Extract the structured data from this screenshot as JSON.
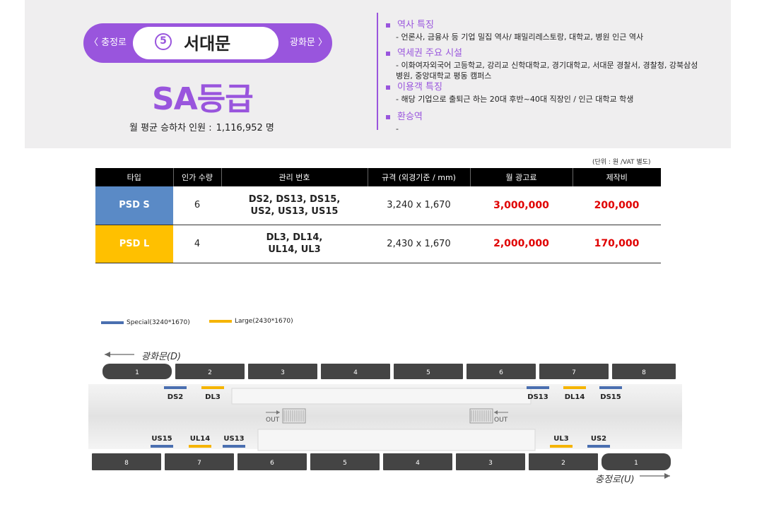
{
  "station": {
    "prev": "〈 충정로",
    "next": "광화문 〉",
    "line_number": "5",
    "name": "서대문",
    "grade": "SA등급",
    "ridership_label": "월 평균 승하차 인원 :",
    "ridership_value": "1,116,952 명",
    "accent_color": "#9955dd"
  },
  "info": [
    {
      "head": "역사 특징",
      "body": "-  언론사, 금융사 등 기업 밀집 역사/ 패밀리레스토랑, 대학교, 병원 인근 역사"
    },
    {
      "head": "역세권 주요 시설",
      "body": "-  이화여자외국어 고등학교, 강리교 신학대학교, 경기대학교, 서대문 경찰서, 경찰청, 강북삼성병원, 중앙대학교 평동 캠퍼스"
    },
    {
      "head": "이용객 특징",
      "body": "-      해당 기업으로 출퇴근 하는 20대 후반~40대 직장인 / 인근 대학교 학생"
    },
    {
      "head": "환승역",
      "body": "-"
    }
  ],
  "table": {
    "unit_note": "(단위 : 원 /VAT 별도)",
    "headers": [
      "타입",
      "인가 수량",
      "관리 번호",
      "규격 (외경기준 / mm)",
      "월 광고료",
      "제작비"
    ],
    "rows": [
      {
        "type": "PSD S",
        "qty": "6",
        "codes_1": "DS2, DS13, DS15,",
        "codes_2": "US2, US13, US15",
        "size": "3,240 x 1,670",
        "fee": "3,000,000",
        "cost": "200,000"
      },
      {
        "type": "PSD L",
        "qty": "4",
        "codes_1": "DL3, DL14,",
        "codes_2": "UL14, UL3",
        "size": "2,430 x 1,670",
        "fee": "2,000,000",
        "cost": "170,000"
      }
    ]
  },
  "legend": {
    "special": "Special(3240*1670)",
    "large": "Large(2430*1670)",
    "special_color": "#4a6fb0",
    "large_color": "#f5b400"
  },
  "diagram": {
    "top_direction": "광화문(D)",
    "bottom_direction": "충정로(U)",
    "out_label": "OUT",
    "top_cars": [
      "1",
      "2",
      "3",
      "4",
      "5",
      "6",
      "7",
      "8"
    ],
    "bottom_cars": [
      "8",
      "7",
      "6",
      "5",
      "4",
      "3",
      "2",
      "1"
    ],
    "top_markers": [
      {
        "label": "DS2",
        "kind": "special"
      },
      {
        "label": "DL3",
        "kind": "large"
      },
      {
        "label": "DS13",
        "kind": "special"
      },
      {
        "label": "DL14",
        "kind": "large"
      },
      {
        "label": "DS15",
        "kind": "special"
      }
    ],
    "bottom_markers": [
      {
        "label": "US15",
        "kind": "special"
      },
      {
        "label": "UL14",
        "kind": "large"
      },
      {
        "label": "US13",
        "kind": "special"
      },
      {
        "label": "UL3",
        "kind": "large"
      },
      {
        "label": "US2",
        "kind": "special"
      }
    ]
  }
}
